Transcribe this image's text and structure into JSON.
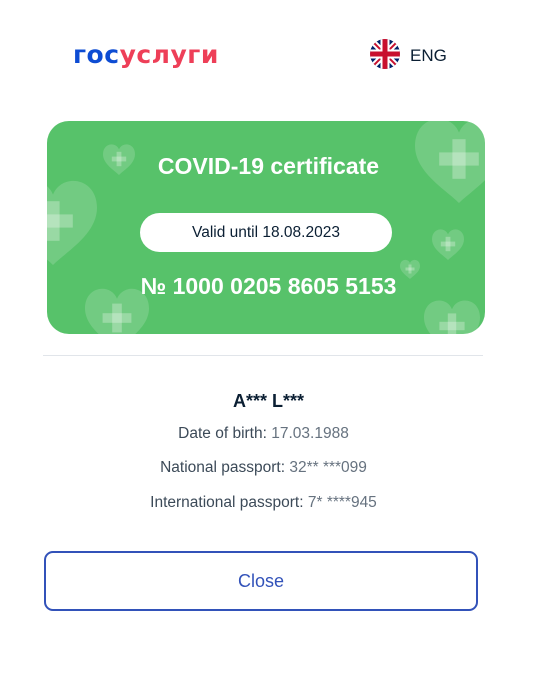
{
  "header": {
    "logo_part1": "гос",
    "logo_part2": "услуги",
    "language_label": "ENG",
    "language_icon": "uk-flag-icon"
  },
  "certificate": {
    "title": "COVID-19 certificate",
    "valid_label": "Valid until 18.08.2023",
    "number": "№ 1000 0205 8605 5153",
    "card_color": "#57c26a",
    "decoration_icons": [
      "heart-cross-icon"
    ]
  },
  "person": {
    "name": "A*** L***",
    "fields": [
      {
        "label": "Date of birth:",
        "value": "17.03.1988"
      },
      {
        "label": "National passport:",
        "value": "32** ***099"
      },
      {
        "label": "International passport:",
        "value": "7* ****945"
      }
    ]
  },
  "actions": {
    "close_label": "Close"
  },
  "colors": {
    "brand_blue": "#0d4cd3",
    "brand_red": "#ee3f58",
    "button_blue": "#3252b9"
  }
}
